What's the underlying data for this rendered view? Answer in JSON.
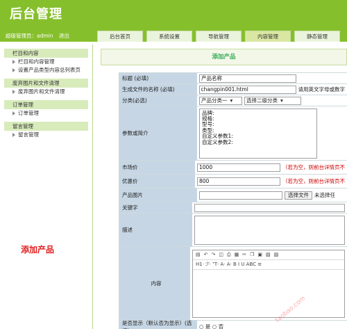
{
  "header": {
    "title": "后台管理",
    "user_text": "超级管理员：admin",
    "logout": "退出"
  },
  "tabs": [
    {
      "label": "后台首页"
    },
    {
      "label": "系统设置"
    },
    {
      "label": "导航管理"
    },
    {
      "label": "内容管理"
    },
    {
      "label": "静态管理"
    }
  ],
  "sidebar": {
    "groups": [
      {
        "title": "栏目和内容",
        "items": [
          "栏目和内容管理",
          "设置产品类型内容总列表页"
        ]
      },
      {
        "title": "废弃图片和文件清理",
        "items": [
          "废弃图片和文件清理"
        ]
      },
      {
        "title": "订单管理",
        "items": [
          "订单管理"
        ]
      },
      {
        "title": "留言管理",
        "items": [
          "留言管理"
        ]
      }
    ]
  },
  "annotation": "添加产品",
  "main": {
    "heading": "添加产品"
  },
  "form": {
    "title_label": "标题 (必填)",
    "title_value": "产品名称",
    "file_label": "生成文件的名称 (必填)",
    "file_value": "changpin001.html",
    "file_hint": "请用英文字母或数字",
    "category_label": "分类(必选)",
    "category_1": "产品分类一",
    "category_2": "选择二级分类",
    "params_label": "参数或简介",
    "params_value": "品牌:\n规格:\n型号:\n类型:\n自定义参数1:\n自定义参数2:",
    "market_label": "市场价",
    "market_value": "1000",
    "market_hint": "（若为空，则前台详情页不",
    "promo_label": "优惠价",
    "promo_value": "800",
    "promo_hint": "（若为空，则前台详情页不",
    "image_label": "产品图片",
    "image_button": "选择文件",
    "image_status": "未选择任",
    "keyword_label": "关键字",
    "desc_label": "描述",
    "content_label": "内容",
    "editor_row2": "H1·  ℱ·  ᵀT·   A·  A·   B  I  U  ABC  ≡",
    "bottom_label": "是否显示（默认否为显示）(选填)",
    "bottom_value": "○ 是  ○ 否"
  },
  "watermark": "taobao.com"
}
